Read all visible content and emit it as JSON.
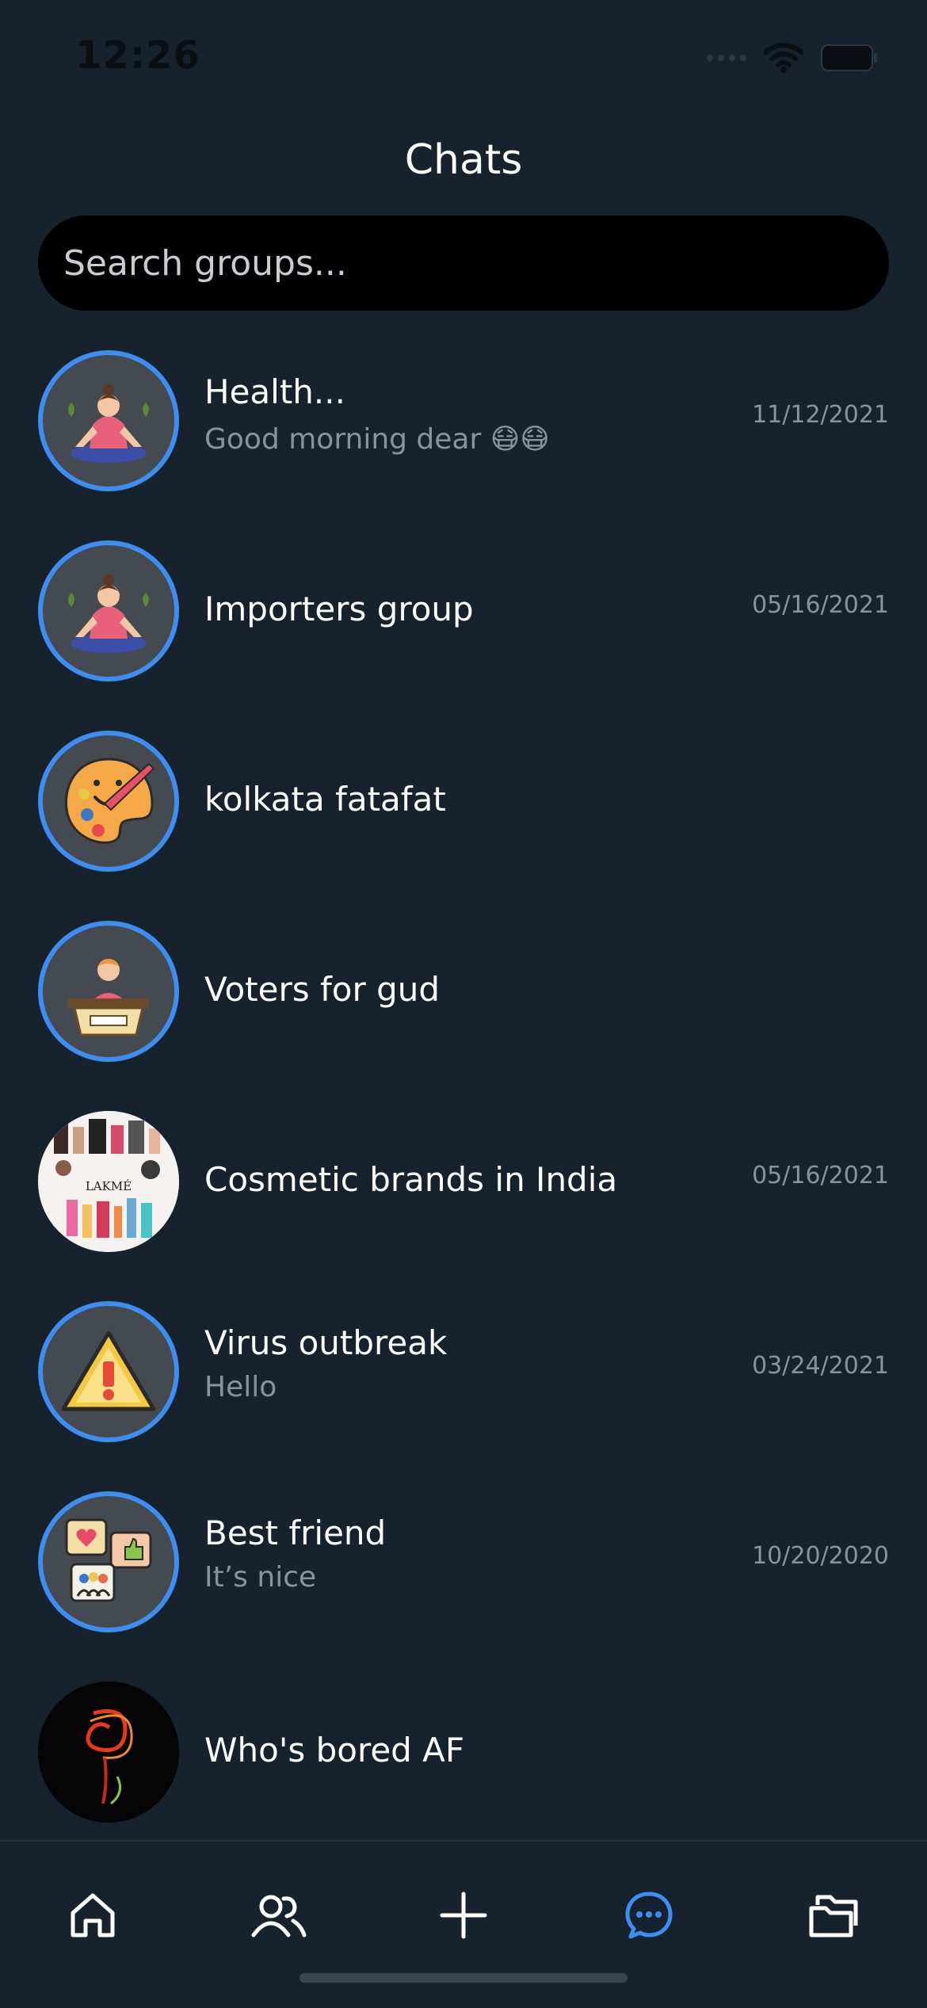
{
  "status_bar": {
    "time": "12:26"
  },
  "header": {
    "title": "Chats"
  },
  "search": {
    "placeholder": "Search groups..."
  },
  "chats": [
    {
      "name": "Health...",
      "last_message": "Good morning dear 😷😷",
      "date": "11/12/2021",
      "avatar_icon": "meditation-icon"
    },
    {
      "name": "Importers group",
      "last_message": "",
      "date": "05/16/2021",
      "avatar_icon": "meditation-icon"
    },
    {
      "name": "kolkata fatafat",
      "last_message": "",
      "date": "",
      "avatar_icon": "paint-palette-icon"
    },
    {
      "name": "Voters for gud",
      "last_message": "",
      "date": "",
      "avatar_icon": "speaker-podium-icon"
    },
    {
      "name": "Cosmetic brands in India",
      "last_message": "",
      "date": "05/16/2021",
      "avatar_icon": "cosmetics-photo",
      "avatar_text": "LAKMÉ"
    },
    {
      "name": "Virus outbreak",
      "last_message": "Hello",
      "date": "03/24/2021",
      "avatar_icon": "warning-icon"
    },
    {
      "name": "Best friend",
      "last_message": "It’s nice",
      "date": "10/20/2020",
      "avatar_icon": "social-chat-icon"
    },
    {
      "name": "Who's bored AF",
      "last_message": "",
      "date": "",
      "avatar_icon": "light-swirl-photo"
    }
  ],
  "tab_bar": {
    "items": [
      {
        "icon": "home-icon",
        "active": false
      },
      {
        "icon": "users-icon",
        "active": false
      },
      {
        "icon": "plus-icon",
        "active": false
      },
      {
        "icon": "chat-bubble-icon",
        "active": true
      },
      {
        "icon": "folders-icon",
        "active": false
      }
    ],
    "active_color": "#3d8ef0",
    "inactive_color": "#ffffff"
  },
  "colors": {
    "background": "#16222d",
    "accent": "#3d8ef0",
    "search_bg": "#000000"
  }
}
